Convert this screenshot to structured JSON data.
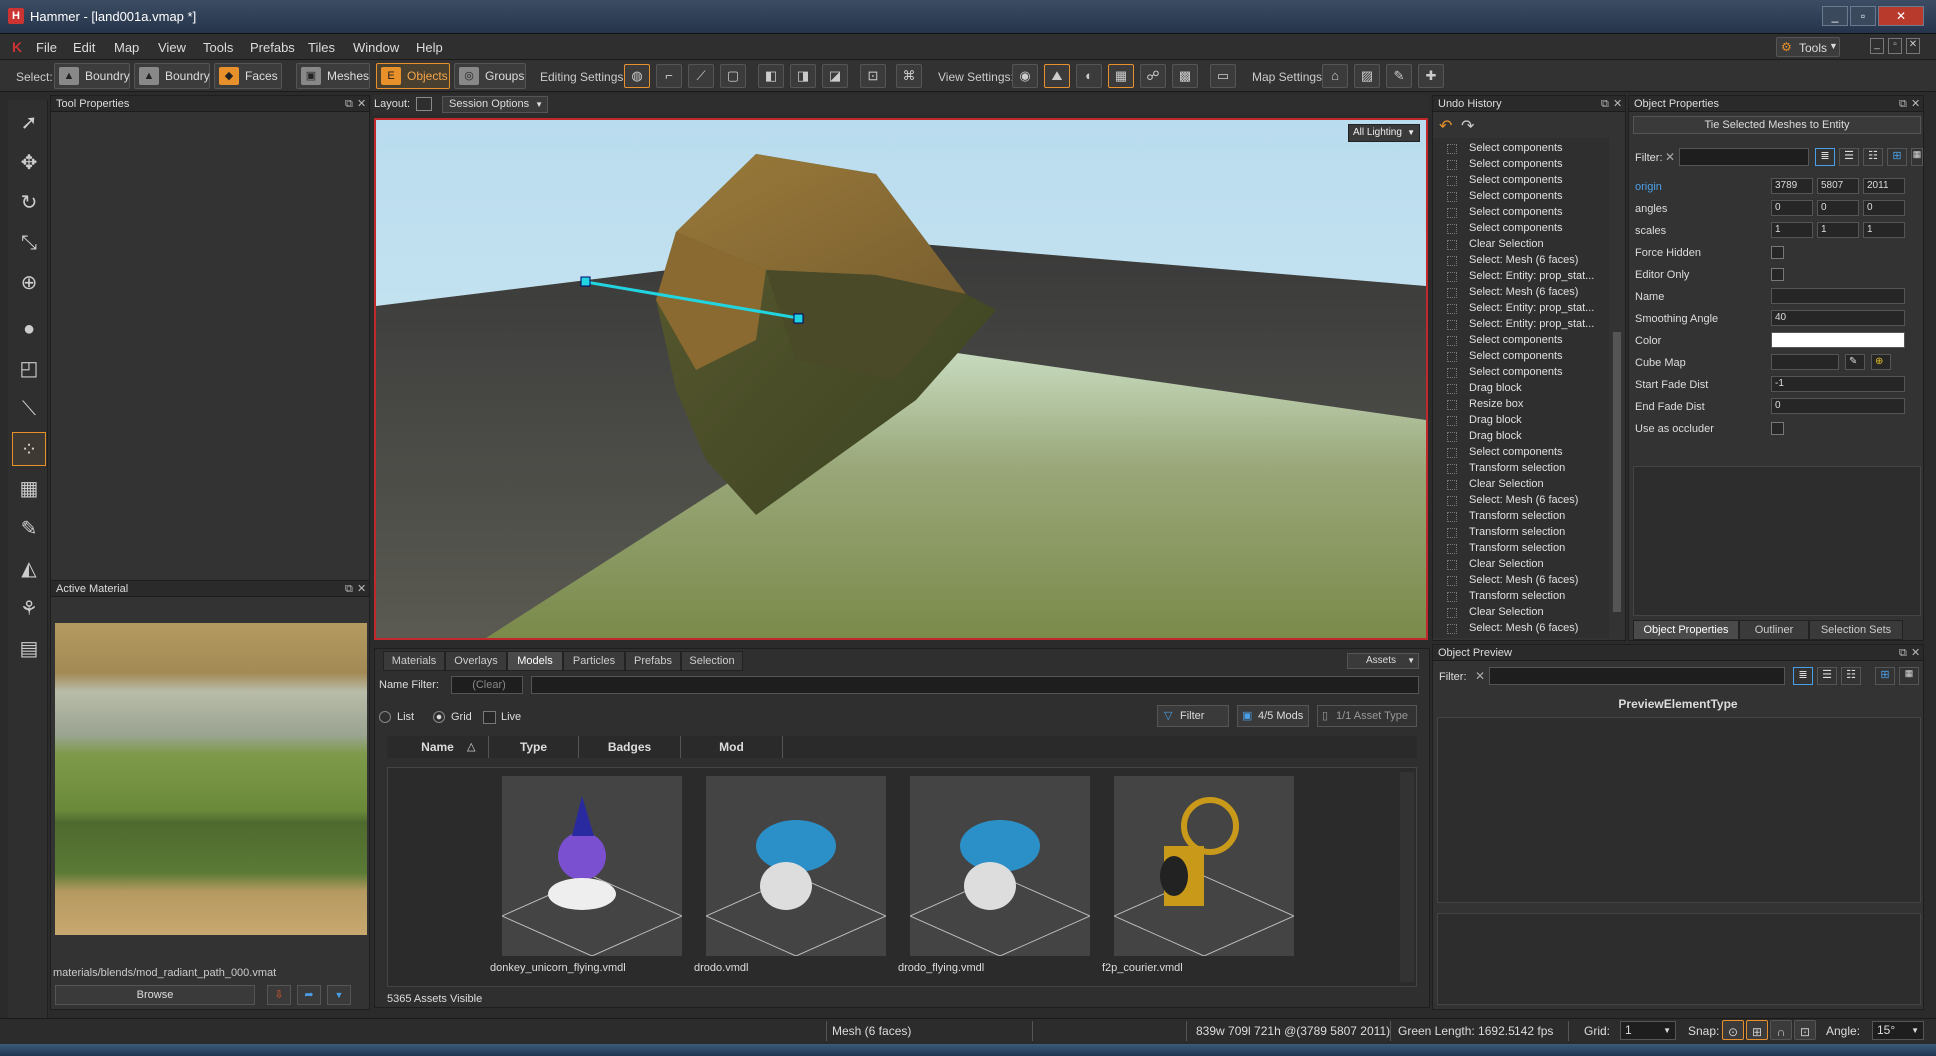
{
  "window": {
    "title": "Hammer - [land001a.vmap *]",
    "min": "_",
    "max": "▫",
    "close": "✕"
  },
  "menu": [
    "File",
    "Edit",
    "Map",
    "View",
    "Tools",
    "Prefabs",
    "Tiles",
    "Window",
    "Help"
  ],
  "menu_right": {
    "tools_label": "Tools"
  },
  "toolbar": {
    "select_label": "Select:",
    "select_modes": [
      {
        "label": "Boundry",
        "icon": "boundry-icon"
      },
      {
        "label": "Boundry",
        "icon": "boundry2-icon"
      },
      {
        "label": "Faces",
        "icon": "faces-icon"
      },
      {
        "label": "Meshes",
        "icon": "meshes-icon"
      },
      {
        "label": "Objects",
        "icon": "objects-icon",
        "active": true
      },
      {
        "label": "Groups",
        "icon": "groups-icon"
      }
    ],
    "editing_label": "Editing Settings:",
    "view_label": "View Settings:",
    "map_label": "Map Settings:"
  },
  "tool_properties": {
    "title": "Tool Properties"
  },
  "active_material": {
    "title": "Active Material",
    "path": "materials/blends/mod_radiant_path_000.vmat",
    "browse": "Browse"
  },
  "layout_bar": {
    "label": "Layout:",
    "session_options": "Session Options"
  },
  "viewport": {
    "lighting": "All Lighting"
  },
  "asset_browser": {
    "tabs": [
      "Materials",
      "Overlays",
      "Models",
      "Particles",
      "Prefabs",
      "Selection"
    ],
    "active_tab": "Models",
    "assets_dropdown": "Assets",
    "name_filter_label": "Name Filter:",
    "clear": "(Clear)",
    "view_list": "List",
    "view_grid": "Grid",
    "live": "Live",
    "filter": "Filter",
    "mods": "4/5 Mods",
    "asset_type": "1/1 Asset Type",
    "columns": [
      "Name",
      "Type",
      "Badges",
      "Mod"
    ],
    "assets": [
      {
        "name": "donkey_unicorn_flying.vmdl",
        "color": "#7a4fd0"
      },
      {
        "name": "drodo.vmdl",
        "color": "#2b8fc8"
      },
      {
        "name": "drodo_flying.vmdl",
        "color": "#2b8fc8"
      },
      {
        "name": "f2p_courier.vmdl",
        "color": "#c99a1a"
      }
    ],
    "status": "5365 Assets Visible"
  },
  "undo_history": {
    "title": "Undo History",
    "items": [
      "Select components",
      "Select components",
      "Select components",
      "Select components",
      "Select components",
      "Select components",
      "Clear Selection",
      "Select: Mesh (6 faces)",
      "Select: Entity: prop_stat...",
      "Select: Mesh (6 faces)",
      "Select: Entity: prop_stat...",
      "Select: Entity: prop_stat...",
      "Select components",
      "Select components",
      "Select components",
      "Drag block",
      "Resize box",
      "Drag block",
      "Drag block",
      "Select components",
      "Transform selection",
      "Clear Selection",
      "Select: Mesh (6 faces)",
      "Transform selection",
      "Transform selection",
      "Transform selection",
      "Clear Selection",
      "Select: Mesh (6 faces)",
      "Transform selection",
      "Clear Selection",
      "Select: Mesh (6 faces)"
    ]
  },
  "object_properties": {
    "title": "Object Properties",
    "tie_button": "Tie Selected Meshes to Entity",
    "filter_label": "Filter:",
    "rows": [
      {
        "label": "origin",
        "values": [
          "3789",
          "5807",
          "2011"
        ],
        "highlight": true
      },
      {
        "label": "angles",
        "values": [
          "0",
          "0",
          "0"
        ]
      },
      {
        "label": "scales",
        "values": [
          "1",
          "1",
          "1"
        ]
      },
      {
        "label": "Force Hidden",
        "check": true
      },
      {
        "label": "Editor Only",
        "check": true
      },
      {
        "label": "Name",
        "text": ""
      },
      {
        "label": "Smoothing Angle",
        "text": "40"
      },
      {
        "label": "Color",
        "color": "#ffffff"
      },
      {
        "label": "Cube Map",
        "dropdown": true
      },
      {
        "label": "Start Fade Dist",
        "text": "-1"
      },
      {
        "label": "End Fade Dist",
        "text": "0"
      },
      {
        "label": "Use as occluder",
        "check": true
      }
    ],
    "tabs": [
      "Object Properties",
      "Outliner",
      "Selection Sets"
    ]
  },
  "object_preview": {
    "title": "Object Preview",
    "filter_label": "Filter:",
    "element": "PreviewElementType"
  },
  "statusbar": {
    "selection": "Mesh (6 faces)",
    "dims": "839w 709l 721h @(3789 5807 2011)",
    "green_length": "Green Length: 1692.5",
    "fps": "142 fps",
    "grid_label": "Grid:",
    "grid_value": "1",
    "snap_label": "Snap:",
    "angle_label": "Angle:",
    "angle_value": "15°"
  }
}
